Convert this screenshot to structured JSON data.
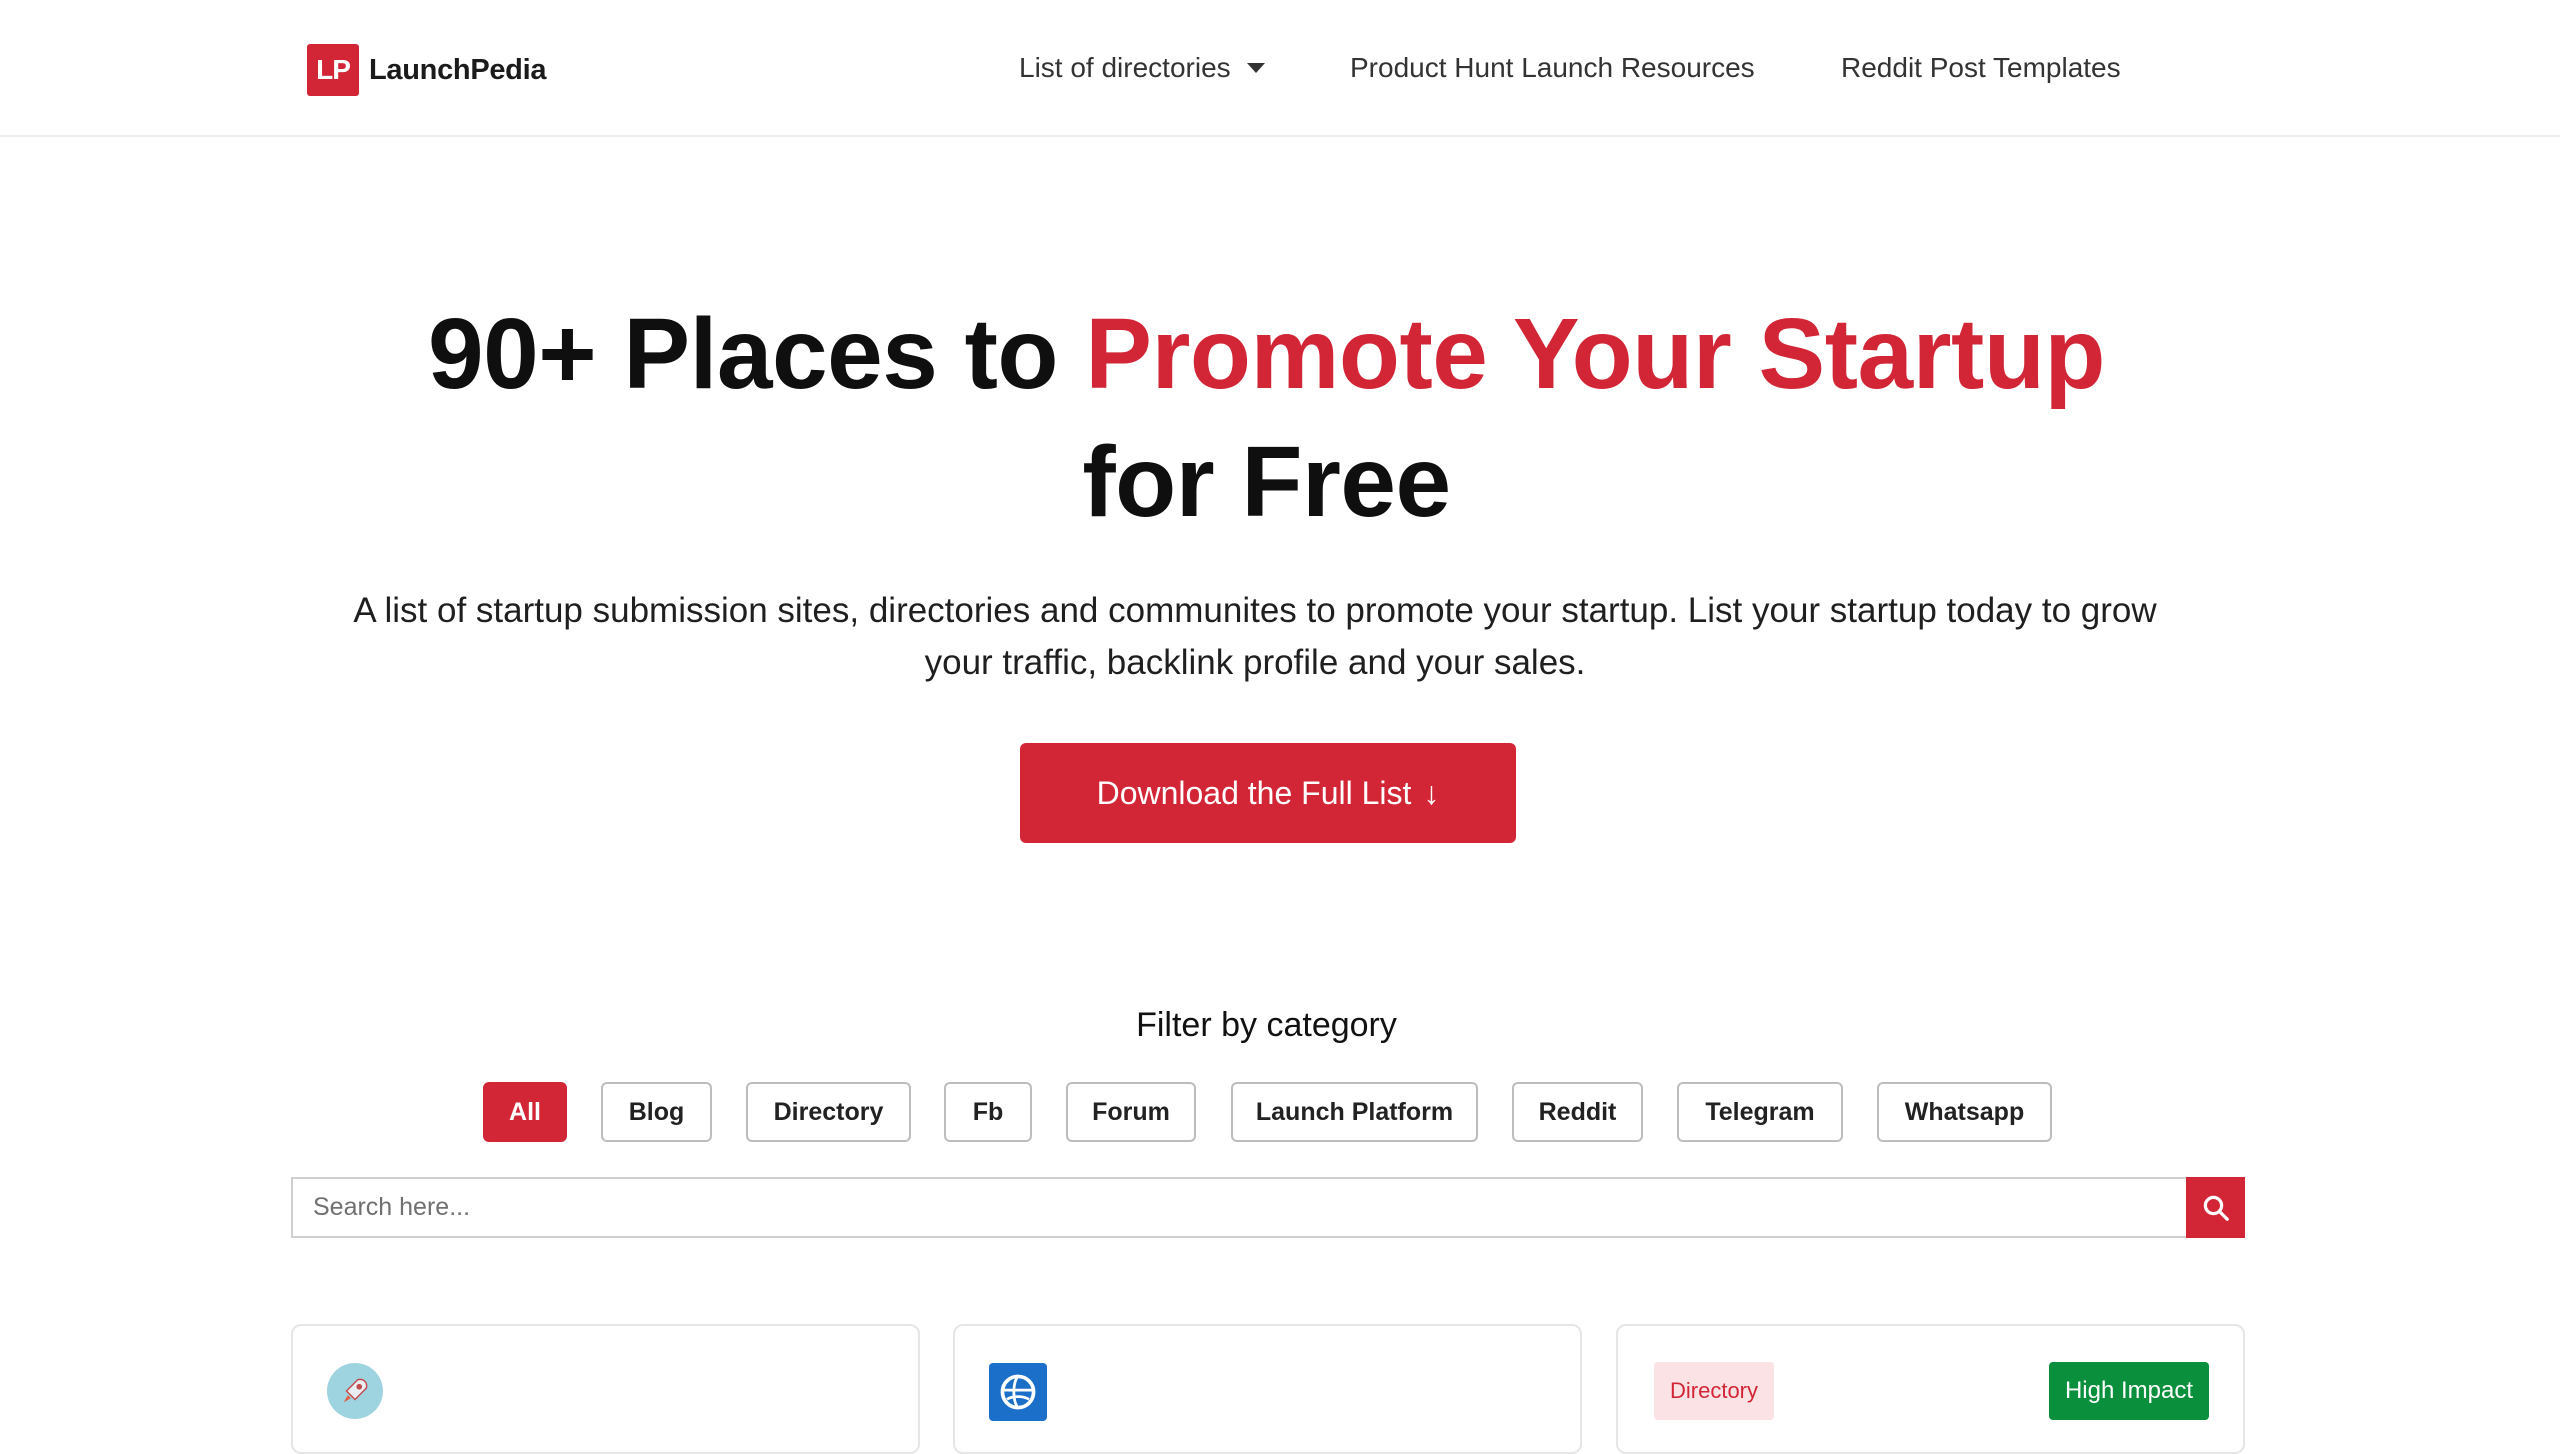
{
  "header": {
    "logo_mark": "LP",
    "logo_text": "LaunchPedia",
    "nav": [
      {
        "label": "List of directories",
        "has_dropdown": true
      },
      {
        "label": "Product Hunt Launch Resources"
      },
      {
        "label": "Reddit Post Templates"
      }
    ]
  },
  "hero": {
    "title_part1": "90+ Places to ",
    "title_accent": "Promote Your Startup",
    "title_part2": "for Free",
    "subtitle": "A list of startup submission sites, directories and communites to promote your startup. List your startup today to grow your traffic, backlink profile and your sales.",
    "cta_label": "Download the Full List",
    "cta_arrow": "↓"
  },
  "filters": {
    "title": "Filter by category",
    "chips": [
      "All",
      "Blog",
      "Directory",
      "Fb",
      "Forum",
      "Launch Platform",
      "Reddit",
      "Telegram",
      "Whatsapp"
    ],
    "active": "All"
  },
  "search": {
    "placeholder": "Search here..."
  },
  "cards": [
    {
      "icon": "rocket-icon"
    },
    {
      "icon": "globe-logo-icon"
    },
    {
      "category": "Directory",
      "impact": "High Impact"
    }
  ],
  "colors": {
    "accent": "#d22637",
    "impact_green": "#0a8f3c",
    "badge_bg": "#fbe3e5"
  }
}
